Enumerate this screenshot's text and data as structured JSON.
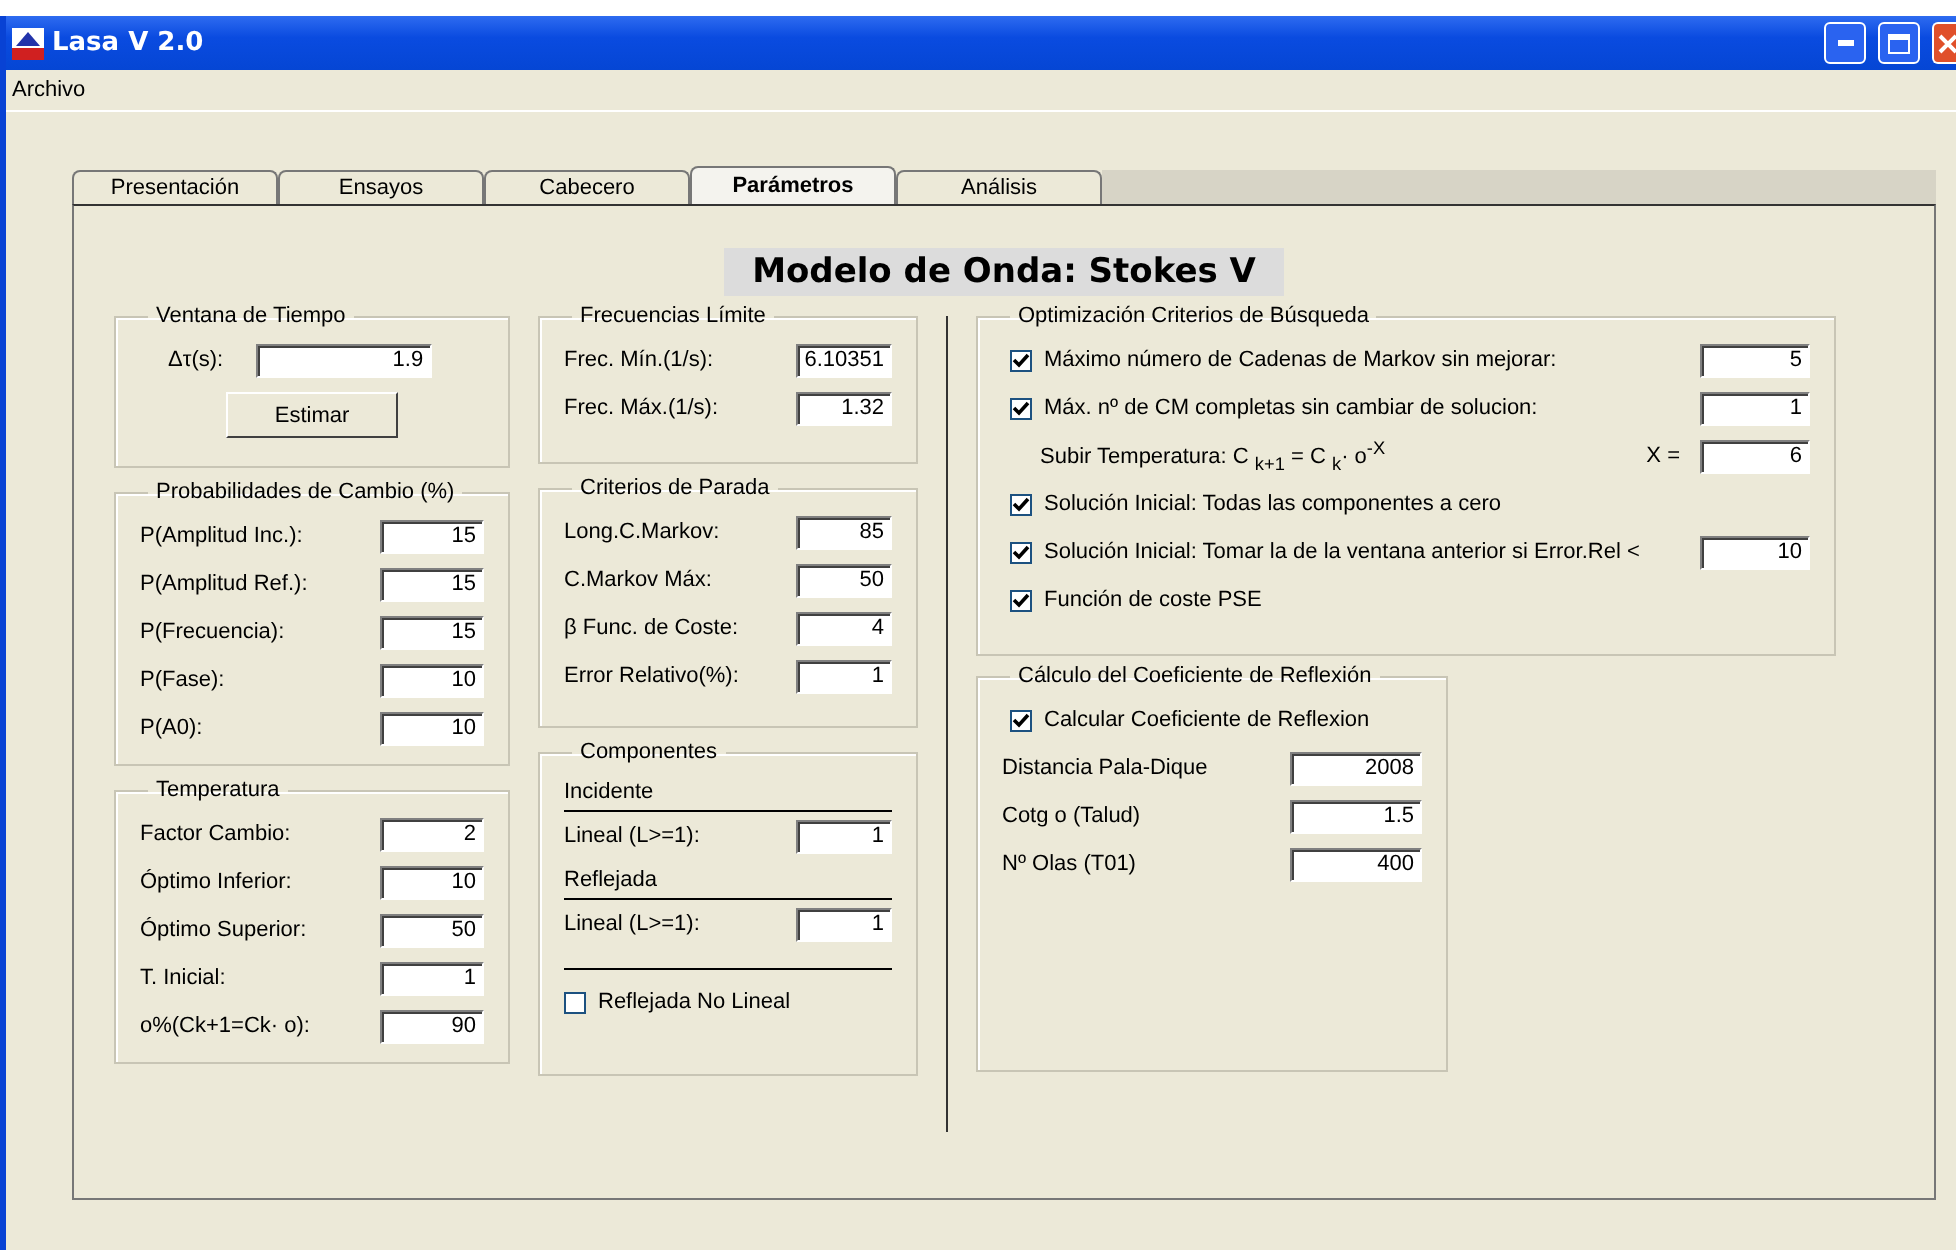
{
  "window": {
    "title": "Lasa V 2.0"
  },
  "menu": [
    "Archivo"
  ],
  "tabs": [
    {
      "label": "Presentación",
      "selected": false
    },
    {
      "label": "Ensayos",
      "selected": false
    },
    {
      "label": "Cabecero",
      "selected": false
    },
    {
      "label": "Parámetros",
      "selected": true
    },
    {
      "label": "Análisis",
      "selected": false
    }
  ],
  "heading": "Modelo de Onda: Stokes V",
  "ventana": {
    "title": "Ventana de Tiempo",
    "label": "Δτ(s):",
    "value": "1.9",
    "button": "Estimar"
  },
  "probabilidades": {
    "title": "Probabilidades de Cambio (%)",
    "fields": [
      {
        "label": "P(Amplitud Inc.):",
        "value": "15"
      },
      {
        "label": "P(Amplitud Ref.):",
        "value": "15"
      },
      {
        "label": "P(Frecuencia):",
        "value": "15"
      },
      {
        "label": "P(Fase):",
        "value": "10"
      },
      {
        "label": "P(A0):",
        "value": "10"
      }
    ]
  },
  "temperatura": {
    "title": "Temperatura",
    "fields": [
      {
        "label": "Factor Cambio:",
        "value": "2"
      },
      {
        "label": "Óptimo Inferior:",
        "value": "10"
      },
      {
        "label": "Óptimo Superior:",
        "value": "50"
      },
      {
        "label": "T. Inicial:",
        "value": "1"
      },
      {
        "label": "o%(Ck+1=Ck· o):",
        "value": "90"
      }
    ]
  },
  "frecuencias": {
    "title": "Frecuencias Límite",
    "fields": [
      {
        "label": "Frec. Mín.(1/s):",
        "value": "6.10351"
      },
      {
        "label": "Frec. Máx.(1/s):",
        "value": "1.32"
      }
    ]
  },
  "criterios": {
    "title": "Criterios de Parada",
    "fields": [
      {
        "label": "Long.C.Markov:",
        "value": "85"
      },
      {
        "label": "C.Markov Máx:",
        "value": "50"
      },
      {
        "label": "β  Func. de Coste:",
        "value": "4"
      },
      {
        "label": "Error Relativo(%):",
        "value": "1"
      }
    ]
  },
  "componentes": {
    "title": "Componentes",
    "sections": [
      {
        "heading": "Incidente",
        "label": "Lineal (L>=1):",
        "value": "1"
      },
      {
        "heading": "Reflejada",
        "label": "Lineal (L>=1):",
        "value": "1"
      }
    ],
    "checkbox": {
      "label": "Reflejada No Lineal",
      "checked": false
    }
  },
  "optimizacion": {
    "title": "Optimización Criterios de Búsqueda",
    "rows": [
      {
        "kind": "check",
        "label": "Máximo número de Cadenas de Markov sin mejorar:",
        "checked": true,
        "value": "5"
      },
      {
        "kind": "check",
        "label": "Máx. nº de CM completas sin cambiar de solucion:",
        "checked": true,
        "value": "1"
      },
      {
        "kind": "formula",
        "label": "Subir Temperatura: C $_{k+1}$ = C $_{k}$· o$^{-X}$",
        "suffix": "X =",
        "value": "6"
      },
      {
        "kind": "check",
        "label": "Solución Inicial: Todas las componentes a cero",
        "checked": true
      },
      {
        "kind": "check",
        "label": "Solución Inicial: Tomar la de la ventana anterior si Error.Rel <",
        "checked": true,
        "value": "10"
      },
      {
        "kind": "check",
        "label": "Función de coste PSE",
        "checked": true
      }
    ]
  },
  "reflexion": {
    "title": "Cálculo del Coeficiente de Reflexión",
    "checkbox": {
      "label": "Calcular Coeficiente de Reflexion",
      "checked": true
    },
    "fields": [
      {
        "label": "Distancia Pala-Dique",
        "value": "2008"
      },
      {
        "label": "Cotg o (Talud)",
        "value": "1.5"
      },
      {
        "label": "Nº Olas (T01)",
        "value": "400"
      }
    ]
  }
}
